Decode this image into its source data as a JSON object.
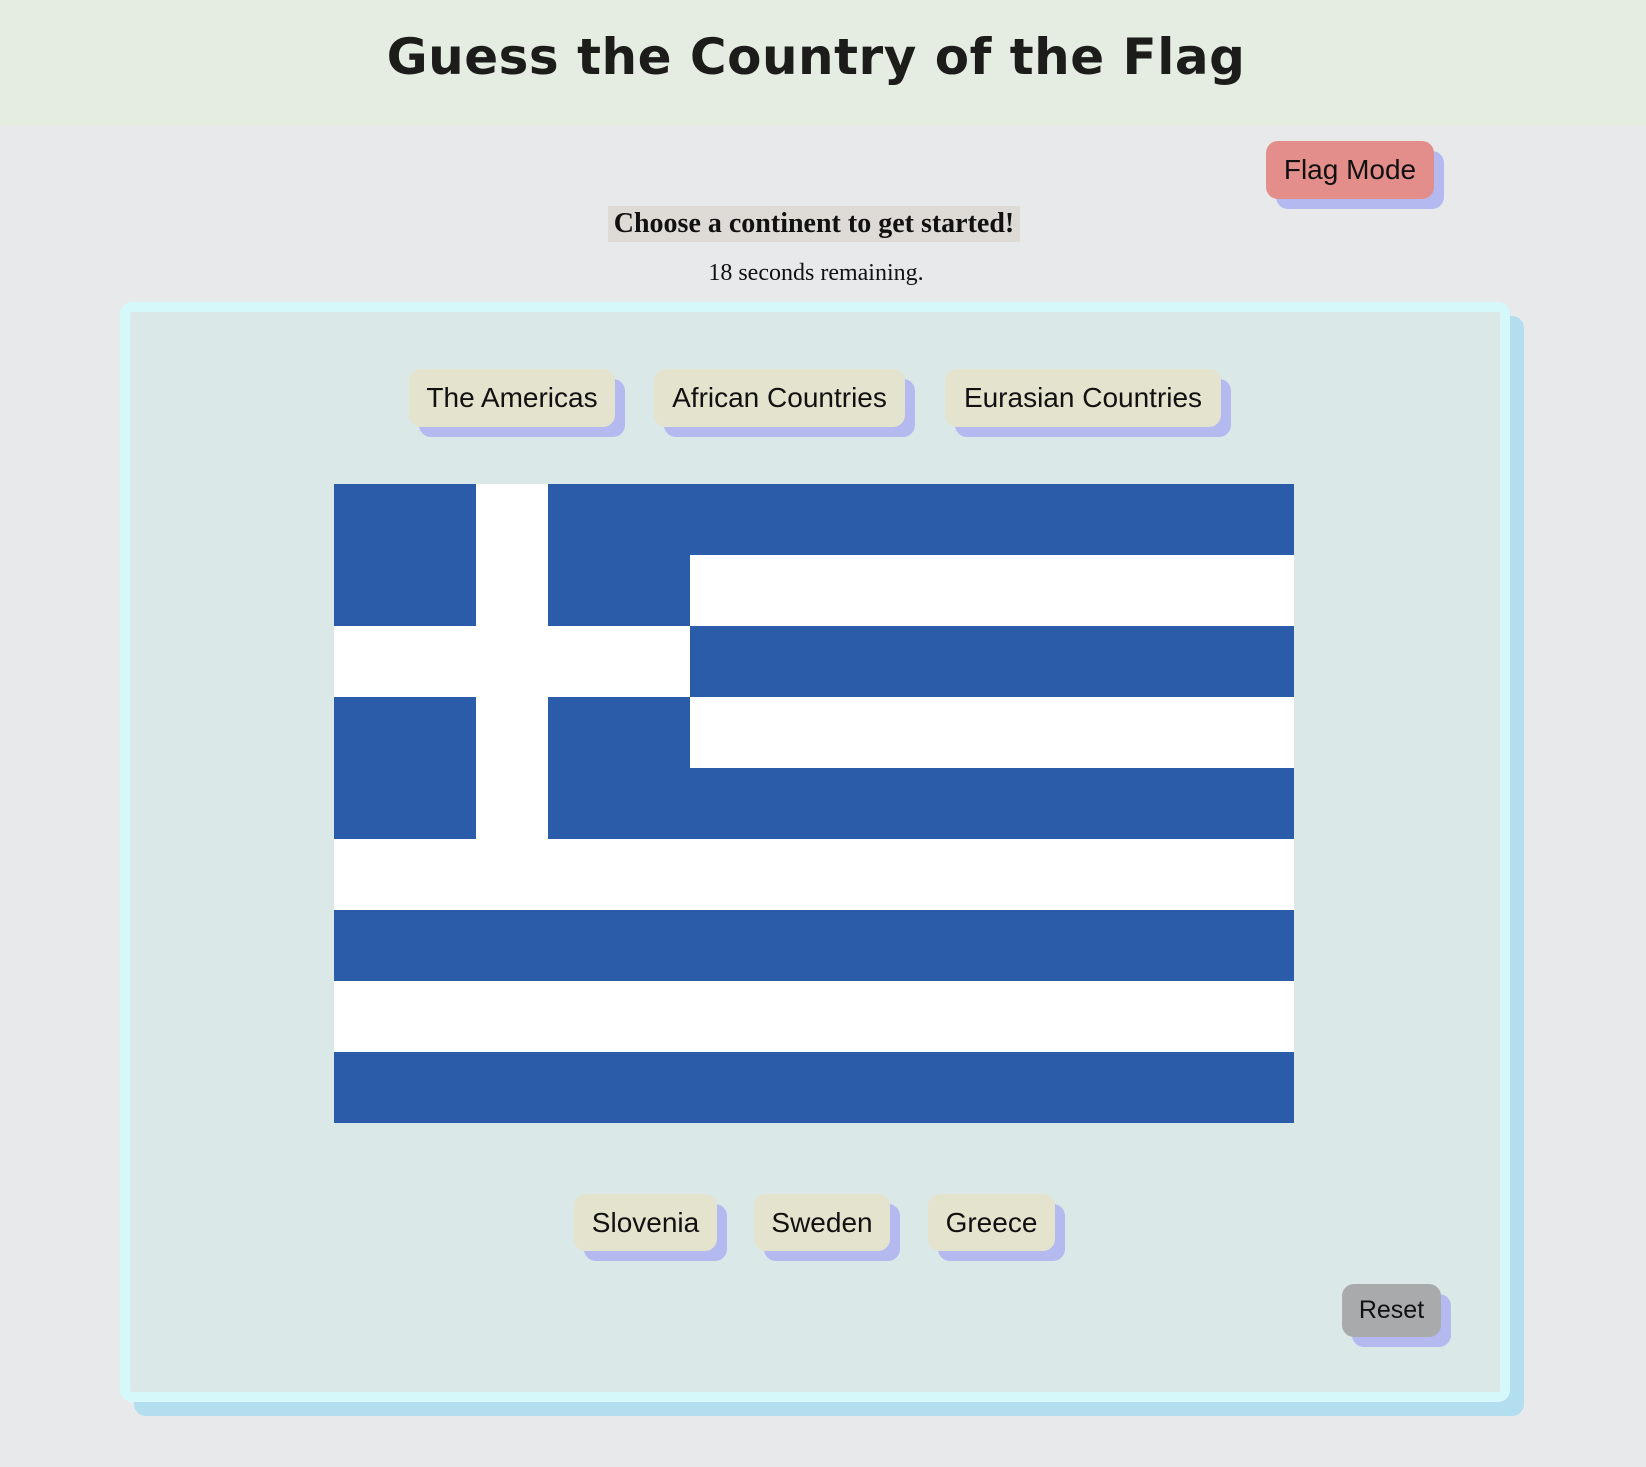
{
  "header": {
    "title": "Guess the Country of the Flag"
  },
  "controls": {
    "mode_button": "Flag Mode",
    "reset_button": "Reset"
  },
  "status": {
    "prompt": "Choose a continent to get started!",
    "timer": "18 seconds remaining."
  },
  "continents": [
    {
      "label": "The Americas"
    },
    {
      "label": "African Countries"
    },
    {
      "label": "Eurasian Countries"
    }
  ],
  "flag": {
    "country_depicted": "Greece",
    "colors": {
      "blue": "#2a5caa",
      "white": "#ffffff"
    }
  },
  "answers": [
    {
      "label": "Slovenia"
    },
    {
      "label": "Sweden"
    },
    {
      "label": "Greece"
    }
  ],
  "colors": {
    "header_bg": "#e5ece2",
    "page_bg": "#e8e9eb",
    "panel_bg": "#dbe8e8",
    "mode_button_bg": "#e38e8a",
    "option_button_bg": "#e3e3ce",
    "reset_button_bg": "#a9aaac",
    "button_shadow": "#b4b9ef"
  }
}
